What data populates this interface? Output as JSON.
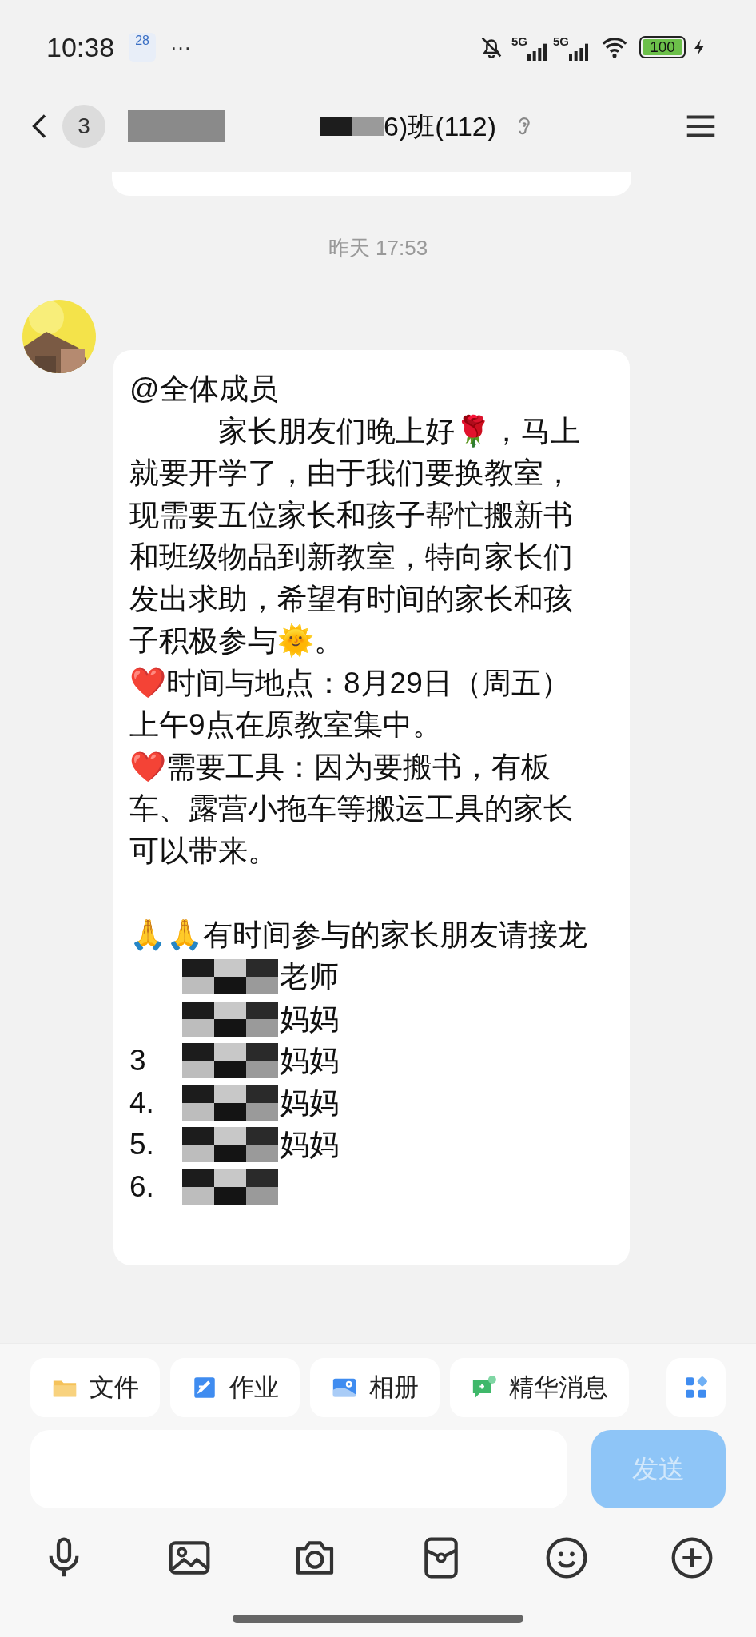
{
  "status_bar": {
    "time": "10:38",
    "calendar_day": "28",
    "more": "···",
    "network_1": "5G",
    "network_2": "5G",
    "battery": "100"
  },
  "header": {
    "unread": "3",
    "title": "6)班(112)"
  },
  "timestamp": "昨天 17:53",
  "message": {
    "paragraphs": [
      "@全体成员",
      "　　　家长朋友们晚上好🌹，马上就要开学了，由于我们要换教室，现需要五位家长和孩子帮忙搬新书和班级物品到新教室，特向家长们发出求助，希望有时间的家长和孩子积极参与🌞。",
      "❤️时间与地点：8月29日（周五）上午9点在原教室集中。",
      "❤️需要工具：因为要搬书，有板车、露营小拖车等搬运工具的家长可以带来。",
      "🙏🙏有时间参与的家长朋友请接龙"
    ],
    "signups": [
      {
        "suffix": "老师"
      },
      {
        "suffix": "妈妈"
      },
      {
        "prefix": "3",
        "suffix": "妈妈"
      },
      {
        "prefix": "4.",
        "suffix": "妈妈"
      },
      {
        "prefix": "5.",
        "suffix": "妈妈"
      },
      {
        "prefix": "6."
      }
    ]
  },
  "shortcuts": [
    {
      "kind": "file",
      "label": "文件"
    },
    {
      "kind": "homework",
      "label": "作业"
    },
    {
      "kind": "album",
      "label": "相册"
    },
    {
      "kind": "highlights",
      "label": "精华消息"
    }
  ],
  "composer": {
    "send": "发送",
    "send_disabled": true
  }
}
